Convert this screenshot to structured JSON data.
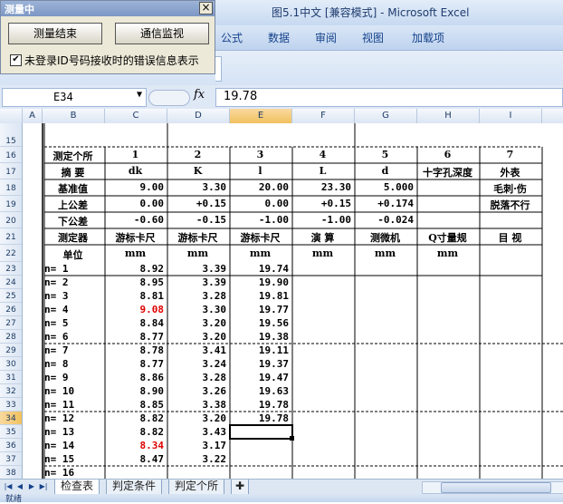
{
  "window": {
    "title": "图5.1中文  [兼容模式] - Microsoft Excel"
  },
  "ribbon": {
    "tabs": [
      "公式",
      "数据",
      "审阅",
      "视图",
      "加载项"
    ]
  },
  "formula_bar": {
    "name_box": "E34",
    "fx_symbol": "fx",
    "value": "19.78"
  },
  "columns": [
    "A",
    "B",
    "C",
    "D",
    "E",
    "F",
    "G",
    "H",
    "I"
  ],
  "selected_column": "E",
  "rows": [
    "15",
    "16",
    "17",
    "18",
    "19",
    "20",
    "21",
    "22",
    "23",
    "24",
    "25",
    "26",
    "27",
    "28",
    "29",
    "30",
    "31",
    "32",
    "33",
    "34",
    "35",
    "36",
    "37",
    "38"
  ],
  "selected_row": "34",
  "sheet": {
    "header_row": [
      "测定个所",
      "1",
      "2",
      "3",
      "4",
      "5",
      "6",
      "7"
    ],
    "spec_rows": [
      [
        "摘 要",
        "dk",
        "K",
        "l",
        "L",
        "d",
        "十字孔深度",
        "外表"
      ],
      [
        "基准值",
        "9.00",
        "3.30",
        "20.00",
        "23.30",
        "5.000",
        "",
        "毛刺·伤"
      ],
      [
        "上公差",
        "0.00",
        "+0.15",
        "0.00",
        "+0.15",
        "+0.174",
        "",
        "脱落不行"
      ],
      [
        "下公差",
        "-0.60",
        "-0.15",
        "-1.00",
        "-1.00",
        "-0.024",
        "",
        ""
      ],
      [
        "测定器",
        "游标卡尺",
        "游标卡尺",
        "游标卡尺",
        "演 算",
        "测微机",
        "Q寸量规",
        "目 视"
      ],
      [
        "单位",
        "mm",
        "mm",
        "mm",
        "mm",
        "mm",
        "mm",
        ""
      ]
    ],
    "data_rows": [
      {
        "n": "n=  1",
        "c": "8.92",
        "d": "3.39",
        "e": "19.74"
      },
      {
        "n": "n=  2",
        "c": "8.95",
        "d": "3.39",
        "e": "19.90"
      },
      {
        "n": "n=  3",
        "c": "8.81",
        "d": "3.28",
        "e": "19.81"
      },
      {
        "n": "n=  4",
        "c": "9.08",
        "d": "3.30",
        "e": "19.77",
        "c_red": true
      },
      {
        "n": "n=  5",
        "c": "8.84",
        "d": "3.20",
        "e": "19.56"
      },
      {
        "n": "n=  6",
        "c": "8.77",
        "d": "3.20",
        "e": "19.38"
      },
      {
        "n": "n=  7",
        "c": "8.78",
        "d": "3.41",
        "e": "19.11"
      },
      {
        "n": "n=  8",
        "c": "8.77",
        "d": "3.24",
        "e": "19.37"
      },
      {
        "n": "n=  9",
        "c": "8.86",
        "d": "3.28",
        "e": "19.47"
      },
      {
        "n": "n= 10",
        "c": "8.90",
        "d": "3.26",
        "e": "19.63"
      },
      {
        "n": "n= 11",
        "c": "8.85",
        "d": "3.38",
        "e": "19.78"
      },
      {
        "n": "n= 12",
        "c": "8.82",
        "d": "3.20",
        "e": "19.78"
      },
      {
        "n": "n= 13",
        "c": "8.82",
        "d": "3.43",
        "e": ""
      },
      {
        "n": "n= 14",
        "c": "8.34",
        "d": "3.17",
        "e": "",
        "c_red": true
      },
      {
        "n": "n= 15",
        "c": "8.47",
        "d": "3.22",
        "e": ""
      },
      {
        "n": "n= 16",
        "c": "",
        "d": "",
        "e": ""
      }
    ]
  },
  "sheet_tabs": [
    "检查表",
    "判定条件",
    "判定个所"
  ],
  "status": {
    "text": "就绪"
  },
  "dialog": {
    "title": "测量中",
    "close_glyph": "×",
    "button_stop": "测量结束",
    "button_monitor": "通信监视",
    "checkbox_checked": true,
    "checkbox_label": "未登录ID号码接收时的错误信息表示"
  },
  "colors": {
    "accent": "#15428b",
    "error": "#e00000",
    "selection": "#f1c15f"
  }
}
